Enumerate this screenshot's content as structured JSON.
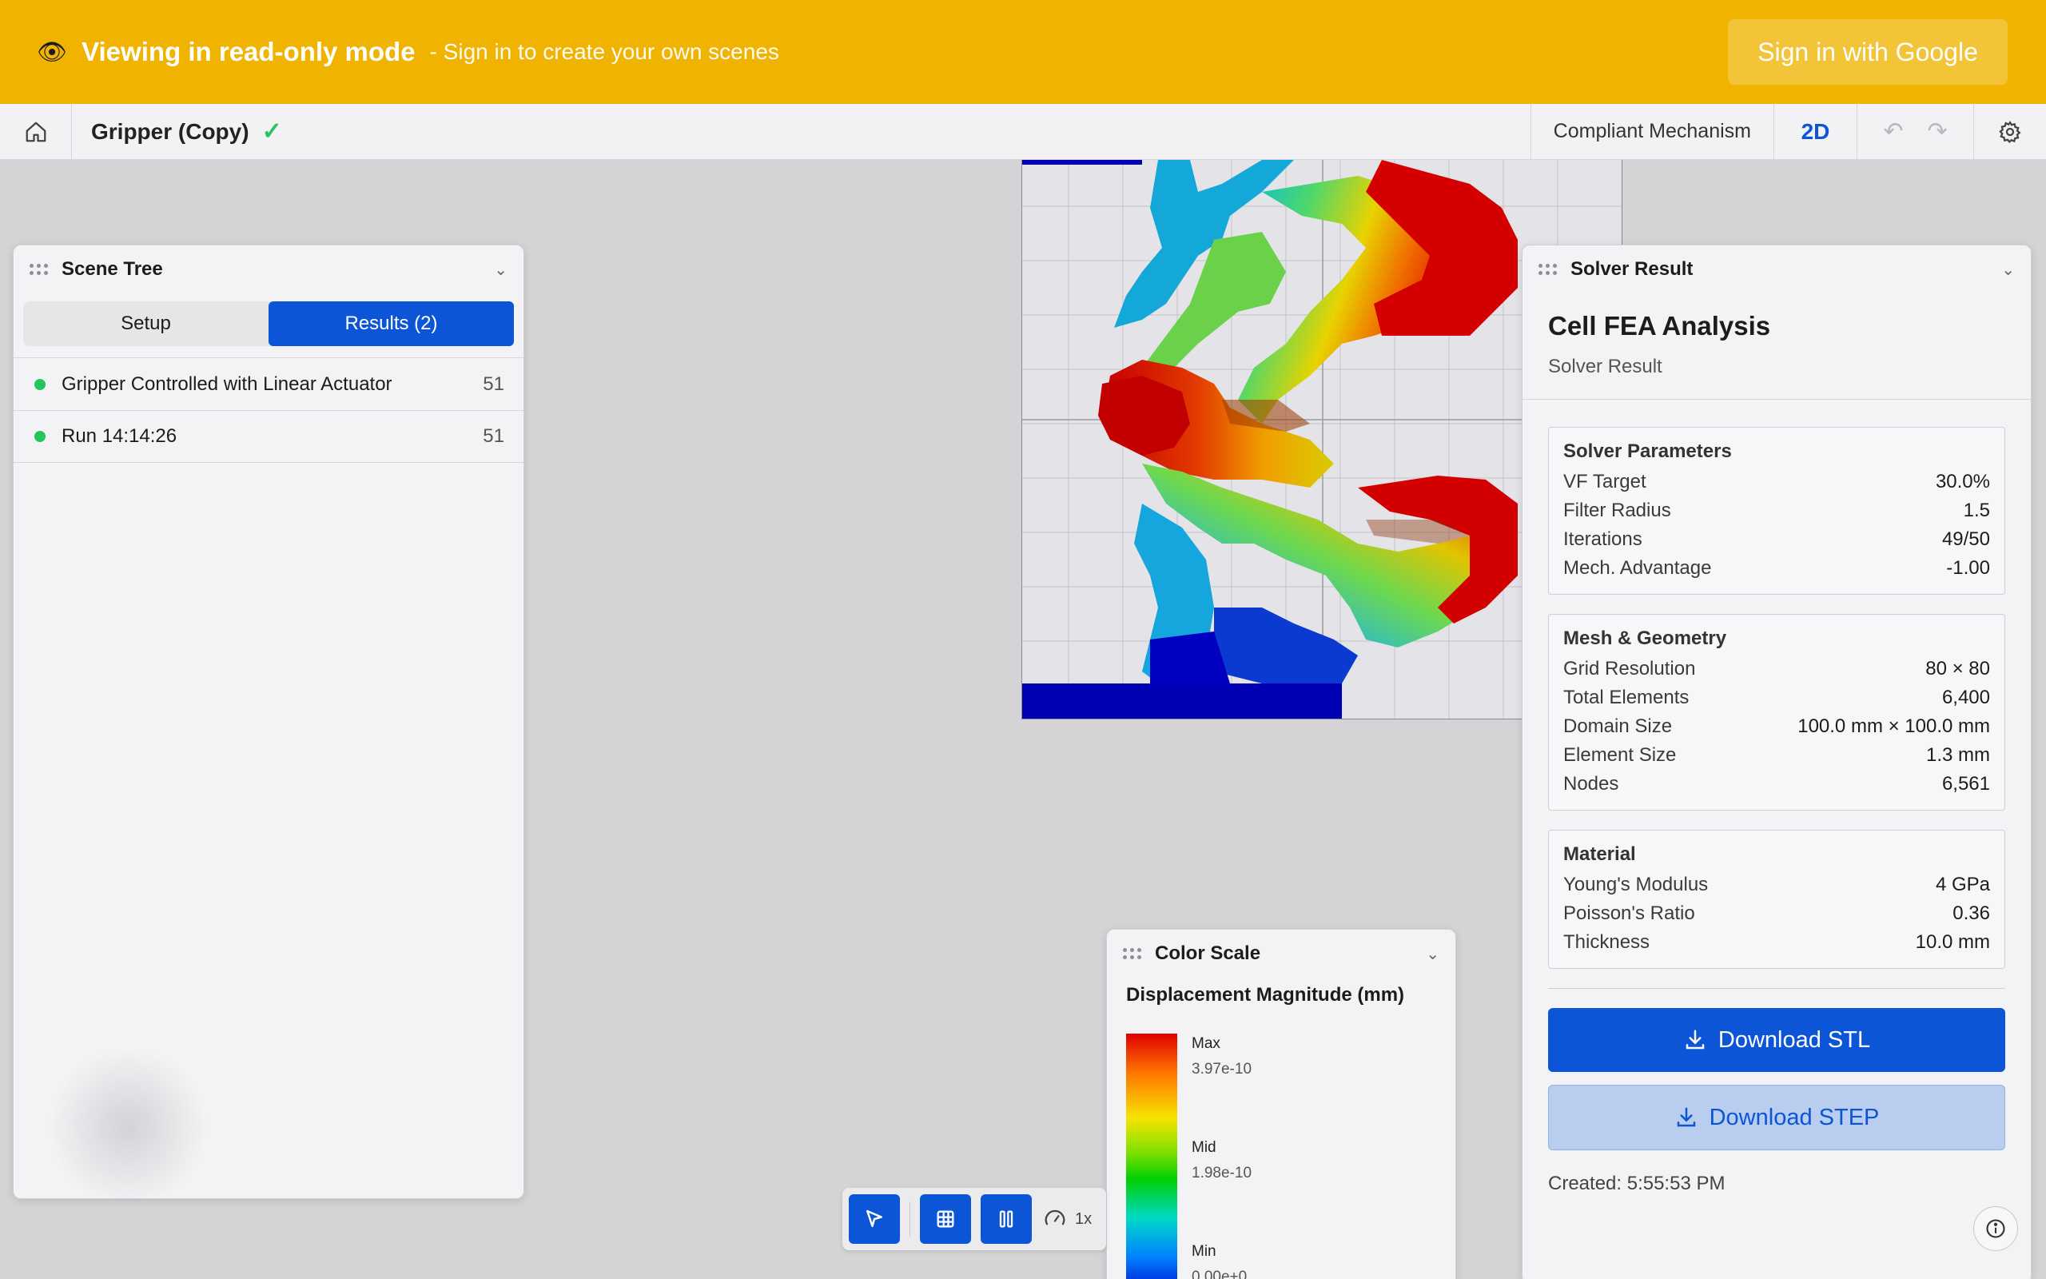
{
  "banner": {
    "icon": "eye-icon",
    "title": "Viewing in read-only mode",
    "subtitle": "- Sign in to create your own scenes",
    "signin_label": "Sign in with Google",
    "bg_color": "#f0b400"
  },
  "toolbar": {
    "scene_title": "Gripper (Copy)",
    "mode_label": "Compliant Mechanism",
    "view_label": "2D"
  },
  "scene_tree": {
    "title": "Scene Tree",
    "tabs": [
      "Setup",
      "Results (2)"
    ],
    "active_tab": "Results (2)",
    "items": [
      {
        "label": "Gripper Controlled with Linear Actuator",
        "count": "51",
        "status_color": "#22c55e"
      },
      {
        "label": "Run 14:14:26",
        "count": "51",
        "status_color": "#22c55e"
      }
    ]
  },
  "solver_result": {
    "panel_title": "Solver Result",
    "heading": "Cell FEA Analysis",
    "subheading": "Solver Result",
    "sections": [
      {
        "title": "Solver Parameters",
        "rows": [
          {
            "k": "VF Target",
            "v": "30.0%"
          },
          {
            "k": "Filter Radius",
            "v": "1.5"
          },
          {
            "k": "Iterations",
            "v": "49/50"
          },
          {
            "k": "Mech. Advantage",
            "v": "-1.00"
          }
        ]
      },
      {
        "title": "Mesh & Geometry",
        "rows": [
          {
            "k": "Grid Resolution",
            "v": "80 × 80"
          },
          {
            "k": "Total Elements",
            "v": "6,400"
          },
          {
            "k": "Domain Size",
            "v": "100.0 mm × 100.0 mm"
          },
          {
            "k": "Element Size",
            "v": "1.3 mm"
          },
          {
            "k": "Nodes",
            "v": "6,561"
          }
        ]
      },
      {
        "title": "Material",
        "rows": [
          {
            "k": "Young's Modulus",
            "v": "4 GPa"
          },
          {
            "k": "Poisson's Ratio",
            "v": "0.36"
          },
          {
            "k": "Thickness",
            "v": "10.0 mm"
          }
        ]
      }
    ],
    "download_stl": "Download STL",
    "download_step": "Download STEP",
    "created": "Created: 5:55:53 PM",
    "accent": "#0b55d6"
  },
  "color_scale": {
    "title": "Color Scale",
    "quantity": "Displacement Magnitude (mm)",
    "max_label": "Max",
    "max_value": "3.97e-10",
    "mid_label": "Mid",
    "mid_value": "1.98e-10",
    "min_label": "Min",
    "min_value": "0.00e+0"
  },
  "playback": {
    "speed_label": "1x"
  }
}
